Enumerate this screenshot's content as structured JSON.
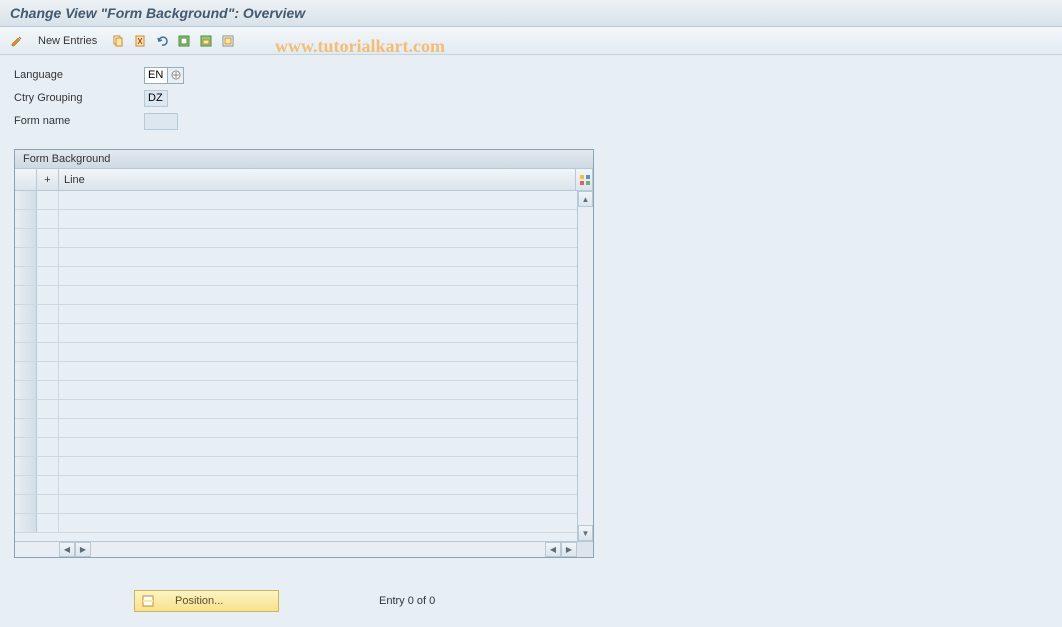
{
  "title": "Change View \"Form Background\": Overview",
  "toolbar": {
    "new_entries_label": "New Entries"
  },
  "watermark": "www.tutorialkart.com",
  "form": {
    "language": {
      "label": "Language",
      "value": "EN"
    },
    "ctry_grouping": {
      "label": "Ctry Grouping",
      "value": "DZ"
    },
    "form_name": {
      "label": "Form name",
      "value": ""
    }
  },
  "table": {
    "title": "Form Background",
    "columns": {
      "plus": "+",
      "line": "Line"
    },
    "rows": [
      "",
      "",
      "",
      "",
      "",
      "",
      "",
      "",
      "",
      "",
      "",
      "",
      "",
      "",
      "",
      "",
      "",
      ""
    ]
  },
  "footer": {
    "position_label": "Position...",
    "entry_text": "Entry 0 of 0"
  }
}
